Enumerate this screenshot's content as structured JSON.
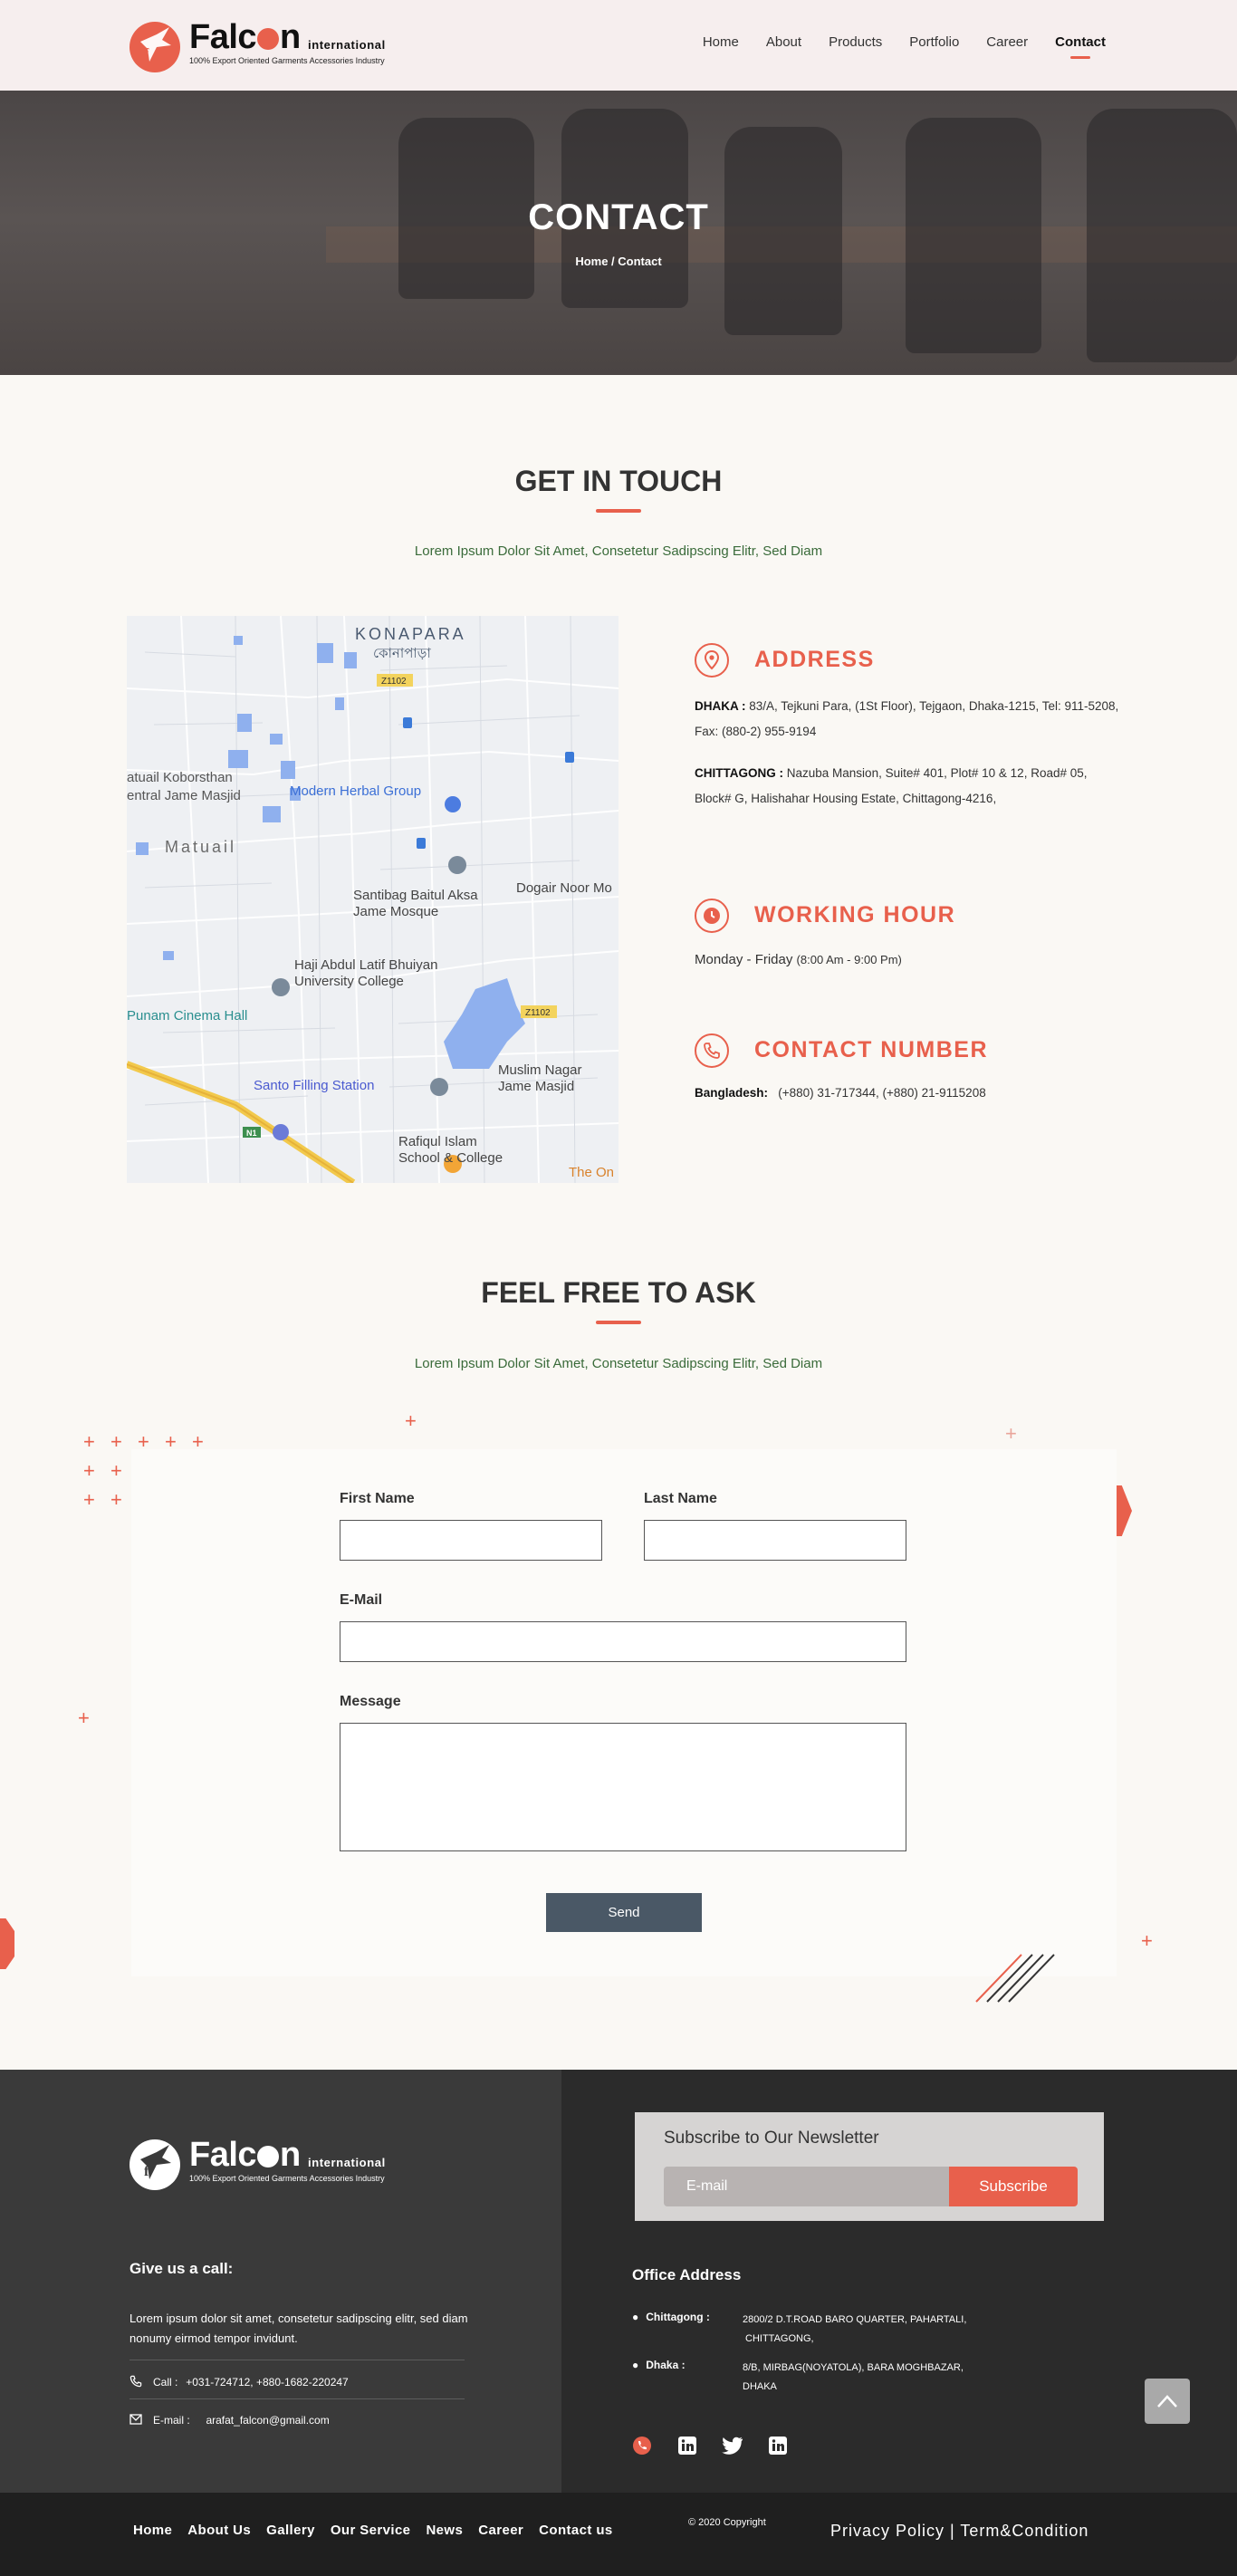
{
  "header": {
    "logo": {
      "name": "Falc",
      "name_end": "n",
      "suffix": "international",
      "tagline": "100% Export Oriented Garments Accessories Industry"
    },
    "nav": [
      "Home",
      "About",
      "Products",
      "Portfolio",
      "Career",
      "Contact"
    ],
    "active_nav": "Contact"
  },
  "hero": {
    "title": "CONTACT",
    "breadcrumb": "Home / Contact"
  },
  "get_in_touch": {
    "title": "GET IN TOUCH",
    "subtitle": "Lorem Ipsum Dolor Sit Amet, Consetetur Sadipscing Elitr, Sed Diam"
  },
  "map": {
    "labels": [
      "KONAPARA",
      "কোনাপাড়া",
      "Z1102",
      "Modern Herbal Group",
      "Matuail",
      "Santibag Baitul Aksa Jame Mosque",
      "Dogair Noor Mo",
      "Haji Abdul Latif Bhuiyan University College",
      "Punam Cinema Hall",
      "Muslim Nagar Jame Masjid",
      "Santo Filling Station",
      "Rafiqul Islam School & College",
      "The On",
      "N1",
      "Z1102",
      "atuail Koborsthan",
      "entral Jame Masjid"
    ]
  },
  "address": {
    "heading": "ADDRESS",
    "dhaka_label": "DHAKA :",
    "dhaka_text": "83/A, Tejkuni Para, (1St Floor), Tejgaon, Dhaka-1215,  Tel: 911-5208, Fax: (880-2) 955-9194",
    "ctg_label": "CHITTAGONG :",
    "ctg_text": "Nazuba Mansion, Suite# 401, Plot# 10 & 12, Road# 05, Block# G, Halishahar Housing Estate, Chittagong-4216,"
  },
  "working_hour": {
    "heading": "WORKING HOUR",
    "days": "Monday - Friday",
    "hours": "(8:00 Am - 9:00 Pm)"
  },
  "contact_number": {
    "heading": "CONTACT NUMBER",
    "label": "Bangladesh:",
    "numbers": "(+880) 31-717344, (+880) 21-9115208"
  },
  "ask": {
    "title": "FEEL FREE TO ASK",
    "subtitle": "Lorem Ipsum Dolor Sit Amet, Consetetur Sadipscing Elitr, Sed Diam"
  },
  "form": {
    "first_name_label": "First Name",
    "last_name_label": "Last Name",
    "email_label": "E-Mail",
    "message_label": "Message",
    "send_label": "Send"
  },
  "footer": {
    "call_heading": "Give us a call:",
    "call_text": "Lorem ipsum dolor sit amet, consetetur sadipscing elitr, sed diam nonumy eirmod tempor invidunt.",
    "call_label": "Call :",
    "call_value": "+031-724712, +880-1682-220247",
    "email_label": "E-mail :",
    "email_value": "arafat_falcon@gmail.com",
    "newsletter_title": "Subscribe to Our Newsletter",
    "newsletter_placeholder": "E-mail",
    "newsletter_button": "Subscribe",
    "office_heading": "Office Address",
    "ctg_label": "Chittagong :",
    "ctg_line1": "2800/2 D.T.ROAD BARO QUARTER, PAHARTALI,",
    "ctg_line2": "CHITTAGONG,",
    "dhaka_label": "Dhaka :",
    "dhaka_line1": "8/B, MIRBAG(NOYATOLA), BARA MOGHBAZAR,",
    "dhaka_line2": "DHAKA"
  },
  "bottom_bar": {
    "links": [
      "Home",
      "About Us",
      "Gallery",
      "Our Service",
      "News",
      "Career",
      "Contact us"
    ],
    "copyright": "© 2020 Copyright",
    "legal": "Privacy Policy | Term&Condition"
  },
  "colors": {
    "accent": "#e8604c",
    "dark": "#2b2b2b",
    "button": "#4a5866"
  }
}
